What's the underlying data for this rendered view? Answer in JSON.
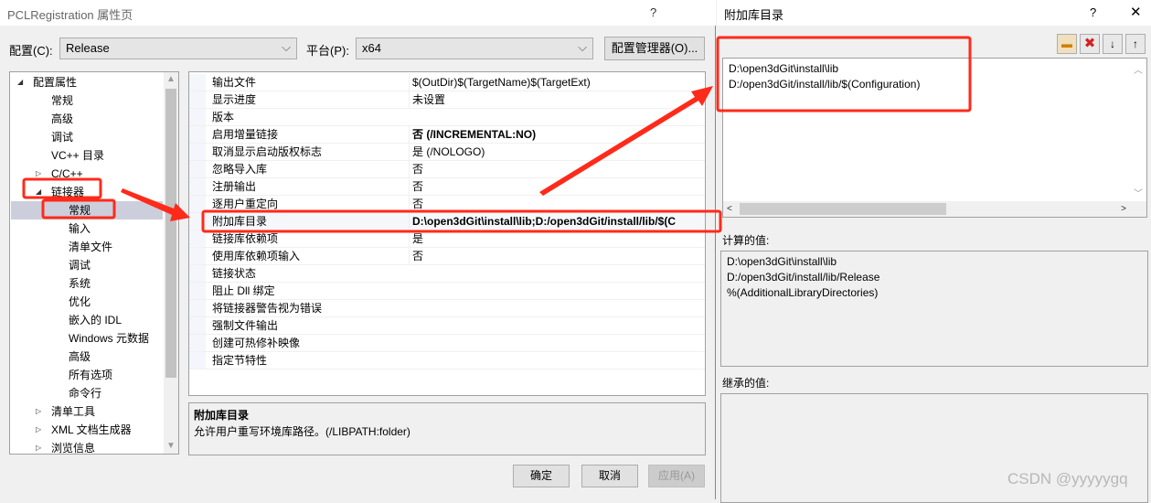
{
  "main_dialog": {
    "title": "PCLRegistration 属性页",
    "help": "?",
    "config_label": "配置(C):",
    "config_value": "Release",
    "platform_label": "平台(P):",
    "platform_value": "x64",
    "config_manager": "配置管理器(O)...",
    "tree": [
      {
        "label": "配置属性",
        "level": 0,
        "expander": "expanded"
      },
      {
        "label": "常规",
        "level": 1
      },
      {
        "label": "高级",
        "level": 1
      },
      {
        "label": "调试",
        "level": 1
      },
      {
        "label": "VC++ 目录",
        "level": 1
      },
      {
        "label": "C/C++",
        "level": 1,
        "expander": "collapsed"
      },
      {
        "label": "链接器",
        "level": 1,
        "expander": "expanded"
      },
      {
        "label": "常规",
        "level": 2,
        "selected": true
      },
      {
        "label": "输入",
        "level": 2
      },
      {
        "label": "清单文件",
        "level": 2
      },
      {
        "label": "调试",
        "level": 2
      },
      {
        "label": "系统",
        "level": 2
      },
      {
        "label": "优化",
        "level": 2
      },
      {
        "label": "嵌入的 IDL",
        "level": 2
      },
      {
        "label": "Windows 元数据",
        "level": 2
      },
      {
        "label": "高级",
        "level": 2
      },
      {
        "label": "所有选项",
        "level": 2
      },
      {
        "label": "命令行",
        "level": 2
      },
      {
        "label": "清单工具",
        "level": 1,
        "expander": "collapsed"
      },
      {
        "label": "XML 文档生成器",
        "level": 1,
        "expander": "collapsed"
      },
      {
        "label": "浏览信息",
        "level": 1,
        "expander": "collapsed"
      }
    ],
    "properties": [
      {
        "name": "输出文件",
        "value": "$(OutDir)$(TargetName)$(TargetExt)"
      },
      {
        "name": "显示进度",
        "value": "未设置"
      },
      {
        "name": "版本",
        "value": ""
      },
      {
        "name": "启用增量链接",
        "value": "否 (/INCREMENTAL:NO)",
        "bold": true
      },
      {
        "name": "取消显示启动版权标志",
        "value": "是 (/NOLOGO)"
      },
      {
        "name": "忽略导入库",
        "value": "否"
      },
      {
        "name": "注册输出",
        "value": "否"
      },
      {
        "name": "逐用户重定向",
        "value": "否"
      },
      {
        "name": "附加库目录",
        "value": "D:\\open3dGit\\install\\lib;D:/open3dGit/install/lib/$(C",
        "bold": true,
        "selected": true
      },
      {
        "name": "链接库依赖项",
        "value": "是"
      },
      {
        "name": "使用库依赖项输入",
        "value": "否"
      },
      {
        "name": "链接状态",
        "value": ""
      },
      {
        "name": "阻止 Dll 绑定",
        "value": ""
      },
      {
        "name": "将链接器警告视为错误",
        "value": ""
      },
      {
        "name": "强制文件输出",
        "value": ""
      },
      {
        "name": "创建可热修补映像",
        "value": ""
      },
      {
        "name": "指定节特性",
        "value": ""
      }
    ],
    "description": {
      "title": "附加库目录",
      "text": "允许用户重写环境库路径。(/LIBPATH:folder)"
    },
    "ok": "确定",
    "cancel": "取消",
    "apply": "应用(A)"
  },
  "lib_dialog": {
    "title": "附加库目录",
    "help": "?",
    "close": "✕",
    "entries": [
      "D:\\open3dGit\\install\\lib",
      "D:/open3dGit/install/lib/$(Configuration)"
    ],
    "computed_label": "计算的值:",
    "computed": [
      "D:\\open3dGit\\install\\lib",
      "D:/open3dGit/install/lib/Release",
      "%(AdditionalLibraryDirectories)"
    ],
    "inherited_label": "继承的值:"
  },
  "watermark": "CSDN @yyyyygq",
  "annotation_color": "#ff2a1a"
}
